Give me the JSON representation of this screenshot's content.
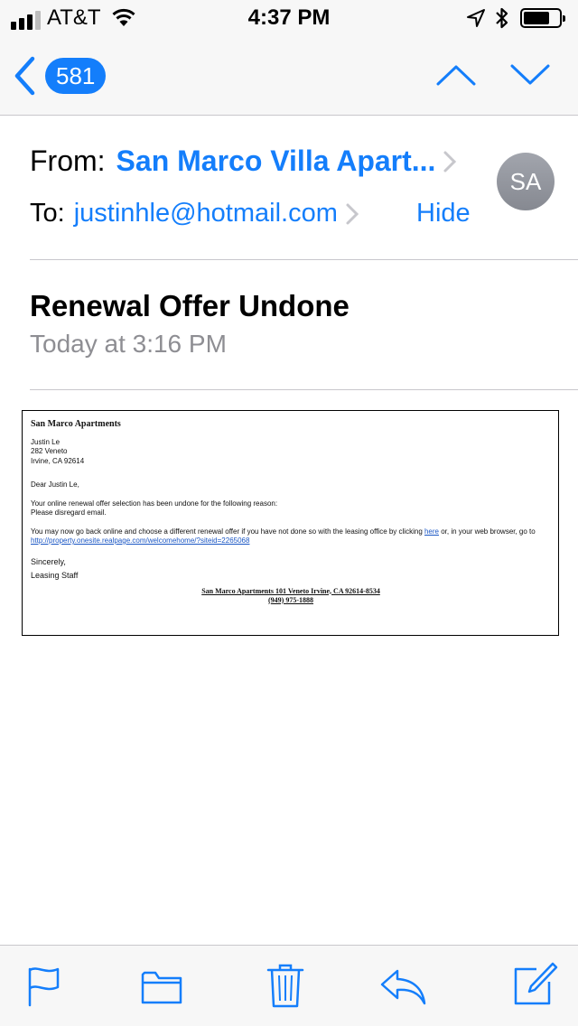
{
  "status_bar": {
    "carrier": "AT&T",
    "time": "4:37 PM",
    "icons": [
      "signal-icon",
      "wifi-icon",
      "location-icon",
      "bluetooth-icon",
      "battery-icon"
    ]
  },
  "nav": {
    "back_count": "581",
    "icons": [
      "chevron-left-icon",
      "chevron-up-icon",
      "chevron-down-icon"
    ]
  },
  "header": {
    "from_label": "From:",
    "from_name": "San Marco Villa Apart...",
    "to_label": "To:",
    "to_address": "justinhle@hotmail.com",
    "hide_label": "Hide",
    "avatar_initials": "SA"
  },
  "subject": "Renewal Offer Undone",
  "date": "Today at 3:16 PM",
  "email_body": {
    "company": "San Marco Apartments",
    "address_lines": [
      "Justin Le",
      "282 Veneto",
      "Irvine, CA 92614"
    ],
    "greeting": "Dear Justin Le,",
    "line1": "Your online renewal offer selection has been undone for the following reason:",
    "line2": "Please disregard email.",
    "para_before_link": "You may now go back online and choose a different renewal offer if you have not done so with the leasing office by clicking ",
    "link_here": "here",
    "para_after_link": " or, in your web browser, go to",
    "url": "http://property.onesite.realpage.com/welcomehome/?siteid=2265068",
    "closing": "Sincerely,",
    "signature": "Leasing Staff",
    "footer_line1": "San Marco Apartments 101 Veneto   Irvine, CA 92614-8534",
    "footer_line2": "(949) 975-1888"
  },
  "toolbar": {
    "icons": [
      "flag-icon",
      "folder-icon",
      "trash-icon",
      "reply-icon",
      "compose-icon"
    ]
  },
  "colors": {
    "accent": "#147efb",
    "secondary_text": "#8e8e93",
    "bar_background": "#f7f7f7",
    "separator": "#c8c7cc",
    "avatar": "#9a9da5"
  }
}
